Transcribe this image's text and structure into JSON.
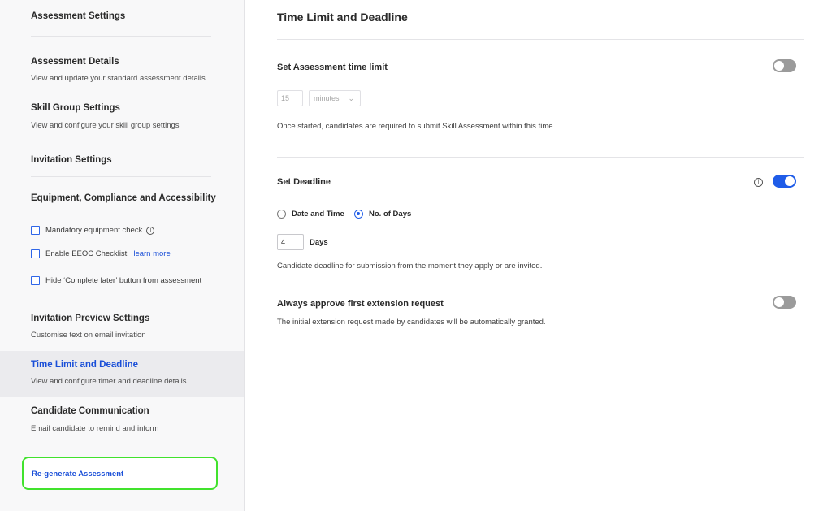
{
  "sidebar": {
    "header": "Assessment Settings",
    "sections": [
      {
        "title": "Assessment Details",
        "desc": "View and update your standard assessment details"
      },
      {
        "title": "Skill Group Settings",
        "desc": "View and configure your skill group settings"
      },
      {
        "title": "Invitation Settings",
        "desc": ""
      },
      {
        "title": "Equipment, Compliance and Accessibility",
        "desc": ""
      },
      {
        "title": "Invitation Preview Settings",
        "desc": "Customise text on email invitation"
      },
      {
        "title": "Time Limit and Deadline",
        "desc": "View and configure timer and deadline details"
      },
      {
        "title": "Candidate Communication",
        "desc": "Email candidate to remind and inform"
      }
    ],
    "checkboxes": [
      {
        "label": "Mandatory equipment check",
        "info_icon": "i"
      },
      {
        "label": "Enable EEOC Checklist",
        "link": "learn more"
      },
      {
        "label": "Hide ‘Complete later’ button from assessment"
      }
    ],
    "regenerate_label": "Re-generate Assessment"
  },
  "main": {
    "title": "Time Limit and Deadline",
    "time_limit": {
      "title": "Set Assessment time limit",
      "value": "15",
      "unit": "minutes",
      "caret": "⌄",
      "desc": "Once started, candidates are required to submit Skill Assessment within this time.",
      "toggle": "off"
    },
    "deadline": {
      "title": "Set Deadline",
      "info_icon": "i",
      "toggle": "on",
      "options": [
        "Date and Time",
        "No. of Days"
      ],
      "selected": "No. of Days",
      "days_value": "4",
      "days_label": "Days",
      "desc": "Candidate deadline for submission from the moment they apply or are invited."
    },
    "extension": {
      "title": "Always approve first extension request",
      "desc": "The initial extension request made by candidates will be automatically granted.",
      "toggle": "off"
    }
  },
  "colors": {
    "accent": "#1f5ce8",
    "link": "#1a4fd8",
    "highlight": "#41e22d"
  }
}
